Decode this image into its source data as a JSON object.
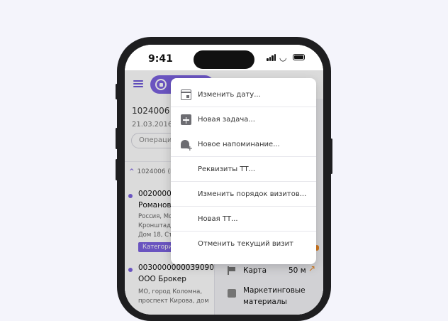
{
  "status_bar": {
    "time": "9:41"
  },
  "toolbar": {
    "menu_icon": "hamburger-icon",
    "action_pill_icon": "stop-circle-icon",
    "accent_color": "#7c62e0"
  },
  "document": {
    "title": "1024006 (",
    "date": "21.03.2016 (",
    "operations_label": "Операции"
  },
  "group": {
    "label": "1024006 (М"
  },
  "clients": [
    {
      "code": "00200000",
      "name": "Романова",
      "address": [
        "Россия, Мос",
        "Кронштадс",
        "Дом 18, Стр"
      ],
      "category": "Категори"
    },
    {
      "code": "0030000000039090",
      "name": "ООО Брокер",
      "address": [
        "МО, город Коломна,",
        "проспект Кирова, дом"
      ]
    }
  ],
  "right_panel": {
    "map_label": "Карта",
    "map_distance": "50 м",
    "marketing_label": "Маркетинговые",
    "marketing_label_2": "материалы"
  },
  "menu": {
    "items": [
      {
        "label": "Изменить дату...",
        "icon": "calendar-icon"
      },
      {
        "label": "Новая задача...",
        "icon": "add-task-icon"
      },
      {
        "label": "Новое напоминание...",
        "icon": "bell-plus-icon"
      },
      {
        "label": "Реквизиты ТТ..."
      },
      {
        "label": "Изменить порядок визитов..."
      },
      {
        "label": "Новая ТТ..."
      },
      {
        "label": "Отменить текущий визит"
      }
    ]
  }
}
